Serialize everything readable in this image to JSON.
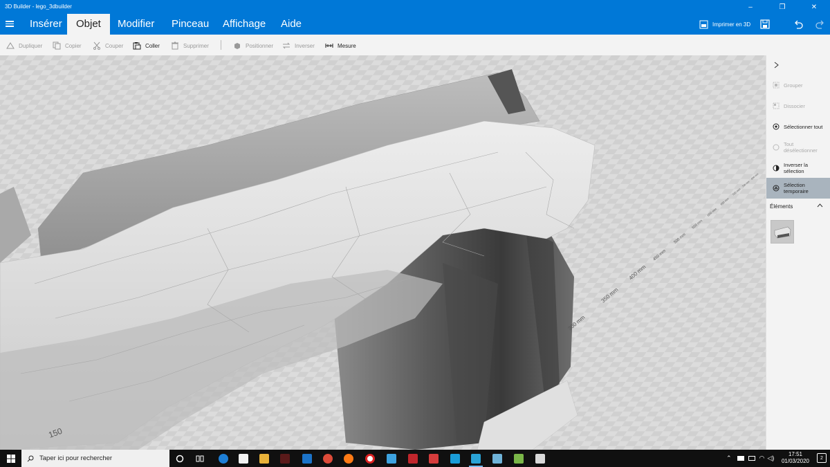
{
  "window": {
    "title": "3D Builder - lego_3dbuilder",
    "minimize": "–",
    "maximize": "❐",
    "close": "✕"
  },
  "ribbon": {
    "tabs": [
      {
        "label": "Insérer"
      },
      {
        "label": "Objet"
      },
      {
        "label": "Modifier"
      },
      {
        "label": "Pinceau"
      },
      {
        "label": "Affichage"
      },
      {
        "label": "Aide"
      }
    ],
    "active_tab": "Objet",
    "print_label": "Imprimer en 3D"
  },
  "toolbar": {
    "dupliquer": "Dupliquer",
    "copier": "Copier",
    "couper": "Couper",
    "coller": "Coller",
    "supprimer": "Supprimer",
    "positionner": "Positionner",
    "inverser": "Inverser",
    "mesure": "Mesure"
  },
  "viewport": {
    "ruler_labels": [
      "150",
      "300 mm",
      "350 mm",
      "400 mm",
      "450 mm",
      "500 mm",
      "550 mm",
      "600 mm",
      "650 mm",
      "700 mm",
      "750 mm",
      "800 mm"
    ]
  },
  "panel": {
    "grouper": "Grouper",
    "dissocier": "Dissocier",
    "selectionner_tout": "Sélectionner tout",
    "tout_deselectionner_1": "Tout",
    "tout_deselectionner_2": "désélectionner",
    "inverser_selection_1": "Inverser la",
    "inverser_selection_2": "sélection",
    "selection_temporaire_1": "Sélection",
    "selection_temporaire_2": "temporaire",
    "elements_label": "Éléments"
  },
  "taskbar": {
    "search_placeholder": "Taper ici pour rechercher",
    "time": "17:51",
    "date": "01/03/2020",
    "notification_count": "2"
  },
  "colors": {
    "accent": "#0078d7",
    "toolbar_bg": "#f3f3f3",
    "selected_item": "#a9b4be",
    "taskbar": "#101010"
  }
}
